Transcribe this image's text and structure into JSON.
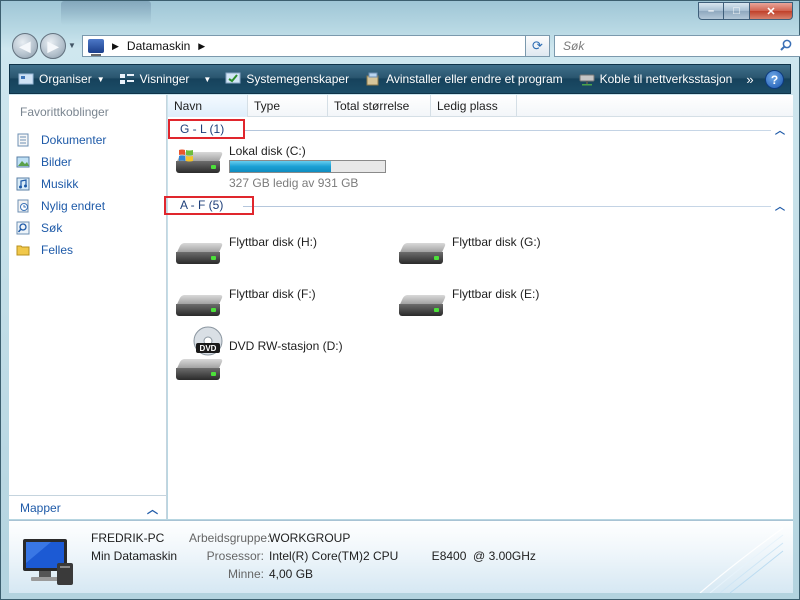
{
  "window": {
    "caption_minimize": "–",
    "caption_maximize": "□",
    "caption_close": "✕"
  },
  "nav": {
    "address_path": "Datamaskin",
    "search_placeholder": "Søk"
  },
  "toolbar": {
    "organize": "Organiser",
    "views": "Visninger",
    "system_properties": "Systemegenskaper",
    "uninstall": "Avinstaller eller endre et program",
    "map_drive": "Koble til nettverksstasjon",
    "more": "»",
    "help": "?"
  },
  "sidebar": {
    "title": "Favorittkoblinger",
    "items": [
      {
        "label": "Dokumenter",
        "icon": "documents-icon"
      },
      {
        "label": "Bilder",
        "icon": "pictures-icon"
      },
      {
        "label": "Musikk",
        "icon": "music-icon"
      },
      {
        "label": "Nylig endret",
        "icon": "recent-icon"
      },
      {
        "label": "Søk",
        "icon": "search-folder-icon"
      },
      {
        "label": "Felles",
        "icon": "public-folder-icon"
      }
    ],
    "folders_label": "Mapper"
  },
  "columns": [
    "Navn",
    "Type",
    "Total størrelse",
    "Ledig plass"
  ],
  "groups": [
    {
      "label": "G - L (1)"
    },
    {
      "label": "A - F (5)"
    }
  ],
  "drives": {
    "c": {
      "label": "Lokal disk (C:)",
      "free_text": "327 GB ledig av 931 GB",
      "used_fraction": 0.65
    },
    "h": {
      "label": "Flyttbar disk (H:)"
    },
    "g": {
      "label": "Flyttbar disk (G:)"
    },
    "f": {
      "label": "Flyttbar disk (F:)"
    },
    "e": {
      "label": "Flyttbar disk (E:)"
    },
    "d": {
      "label": "DVD RW-stasjon (D:)",
      "badge": "DVD"
    }
  },
  "details": {
    "computer_name": "FREDRIK-PC",
    "computer_type": "Min Datamaskin",
    "workgroup_label": "Arbeidsgruppe:",
    "workgroup_value": "WORKGROUP",
    "processor_label": "Prosessor:",
    "processor_value": "Intel(R) Core(TM)2 CPU          E8400  @ 3.00GHz",
    "memory_label": "Minne:",
    "memory_value": "4,00 GB"
  },
  "colors": {
    "accent_link": "#1e5aa8",
    "highlight_box": "#e0262d",
    "usage_bar": "#1ba0d4"
  }
}
